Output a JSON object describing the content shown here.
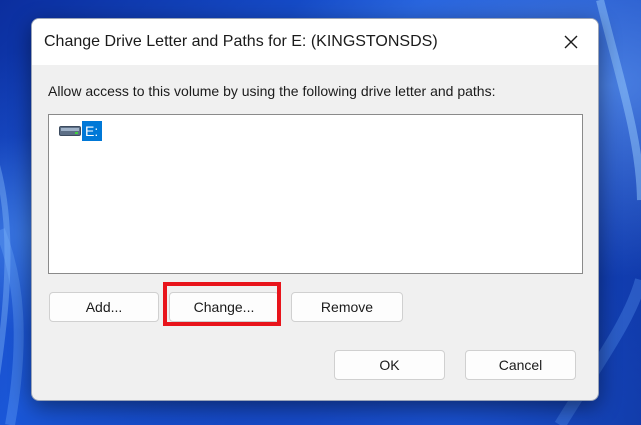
{
  "dialog": {
    "title": "Change Drive Letter and Paths for E: (KINGSTONSDS)",
    "close_icon": "close-icon",
    "instruction": "Allow access to this volume by using the following drive letter and paths:",
    "list": {
      "items": [
        {
          "icon": "drive-icon",
          "label": "E:",
          "selected": true
        }
      ]
    },
    "buttons": {
      "add_label": "Add...",
      "change_label": "Change...",
      "remove_label": "Remove",
      "ok_label": "OK",
      "cancel_label": "Cancel"
    },
    "highlighted_button": "change"
  },
  "colors": {
    "selection": "#0078d7",
    "highlight": "#e8141b",
    "dialog_bg": "#f0f0f0",
    "wallpaper": "#1340b8"
  }
}
